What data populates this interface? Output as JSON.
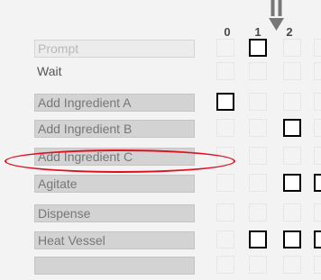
{
  "columns": [
    "0",
    "1",
    "2"
  ],
  "rows": [
    {
      "label": "Prompt",
      "style": "empty",
      "cells": [
        false,
        true,
        false,
        false
      ]
    },
    {
      "label": "Wait",
      "style": "plain",
      "cells": [
        false,
        false,
        false,
        false
      ]
    },
    {
      "label": "Add Ingredient A",
      "style": "box",
      "cells": [
        true,
        false,
        false,
        false
      ]
    },
    {
      "label": "Add Ingredient B",
      "style": "box",
      "cells": [
        false,
        false,
        true,
        false
      ]
    },
    {
      "label": "Add Ingredient C",
      "style": "box",
      "cells": [
        false,
        false,
        false,
        false
      ]
    },
    {
      "label": "Agitate",
      "style": "box",
      "cells": [
        false,
        false,
        true,
        true
      ]
    },
    {
      "label": "Dispense",
      "style": "box",
      "cells": [
        false,
        false,
        false,
        false
      ]
    },
    {
      "label": "Heat Vessel",
      "style": "box",
      "cells": [
        false,
        true,
        true,
        true
      ]
    },
    {
      "label": "",
      "style": "box",
      "cells": [
        false,
        false,
        false,
        false
      ]
    }
  ],
  "highlighted_row": "Add Ingredient C",
  "colors": {
    "highlight": "#e0101e",
    "cell_border_on": "#000000"
  }
}
